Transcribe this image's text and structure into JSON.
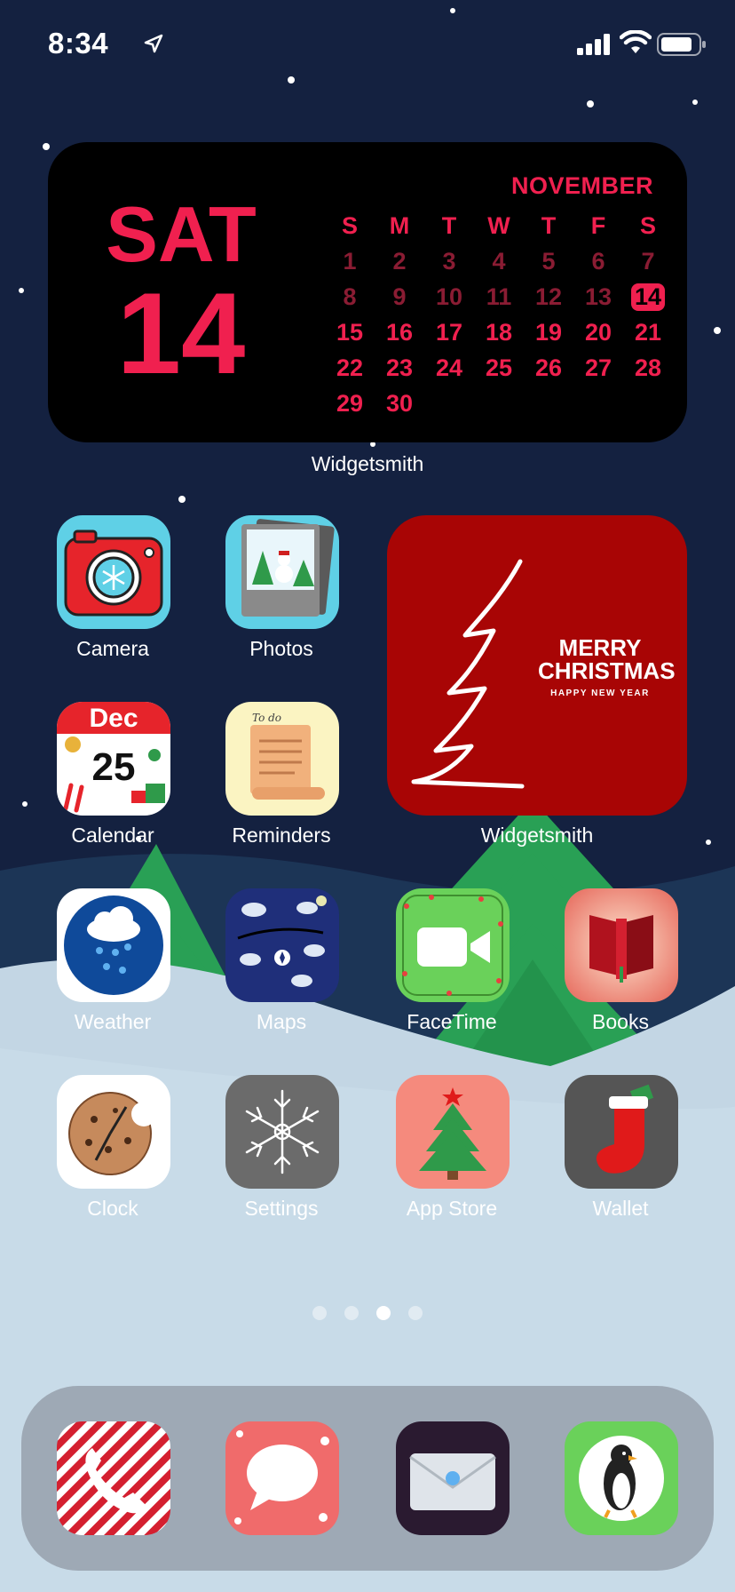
{
  "status_bar": {
    "time": "8:34",
    "icons": [
      "location-arrow-icon",
      "cellular-signal-icon",
      "wifi-icon",
      "battery-icon"
    ]
  },
  "calendar_widget": {
    "day_of_week": "SAT",
    "date": "14",
    "month": "NOVEMBER",
    "weekday_headers": [
      "S",
      "M",
      "T",
      "W",
      "T",
      "F",
      "S"
    ],
    "weeks": [
      [
        "1",
        "2",
        "3",
        "4",
        "5",
        "6",
        "7"
      ],
      [
        "8",
        "9",
        "10",
        "11",
        "12",
        "13",
        "14"
      ],
      [
        "15",
        "16",
        "17",
        "18",
        "19",
        "20",
        "21"
      ],
      [
        "22",
        "23",
        "24",
        "25",
        "26",
        "27",
        "28"
      ],
      [
        "29",
        "30",
        "",
        "",
        "",
        "",
        ""
      ]
    ],
    "label": "Widgetsmith",
    "accent_color": "#f0204f"
  },
  "christmas_widget": {
    "line1": "MERRY",
    "line2": "CHRISTMAS",
    "line3": "HAPPY NEW YEAR",
    "label": "Widgetsmith",
    "background_color": "#a80505"
  },
  "apps": {
    "camera": "Camera",
    "photos": "Photos",
    "calendar": "Calendar",
    "calendar_icon_month": "Dec",
    "calendar_icon_day": "25",
    "reminders": "Reminders",
    "reminders_note": "To do",
    "weather": "Weather",
    "maps": "Maps",
    "facetime": "FaceTime",
    "books": "Books",
    "clock": "Clock",
    "settings": "Settings",
    "app_store": "App Store",
    "wallet": "Wallet"
  },
  "page_dots": {
    "count": 4,
    "active_index": 2
  },
  "dock": [
    "phone-icon",
    "messages-icon",
    "mail-icon",
    "penguin-icon"
  ]
}
